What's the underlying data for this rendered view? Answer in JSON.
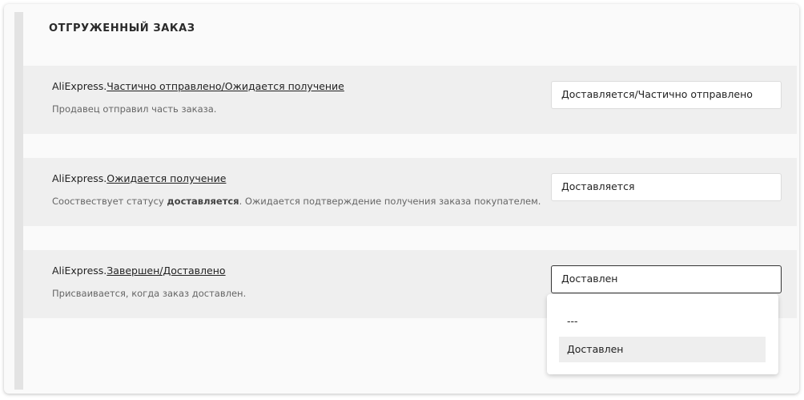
{
  "section": {
    "title": "ОТГРУЖЕННЫЙ ЗАКАЗ"
  },
  "rows": [
    {
      "prefix": "AliExpress.",
      "link": "Частично отправлено/Ожидается получение",
      "desc": "Продавец отправил часть заказа.",
      "desc_pre": "",
      "desc_bold": "",
      "desc_post": "",
      "selected": "Доставляется/Частично отправлено"
    },
    {
      "prefix": "AliExpress.",
      "link": "Ожидается получение",
      "desc": "",
      "desc_pre": "Сооствествует статусу ",
      "desc_bold": "доставляется",
      "desc_post": ". Ожидается подтверждение получения заказа покупателем.",
      "selected": "Доставляется"
    },
    {
      "prefix": "AliExpress.",
      "link": "Завершен/Доставлено",
      "desc": "Присваивается, когда заказ доставлен.",
      "desc_pre": "",
      "desc_bold": "",
      "desc_post": "",
      "selected": "Доставлен"
    }
  ],
  "dropdown": {
    "options": [
      "---",
      "Доставлен"
    ],
    "highlighted": "Доставлен"
  }
}
